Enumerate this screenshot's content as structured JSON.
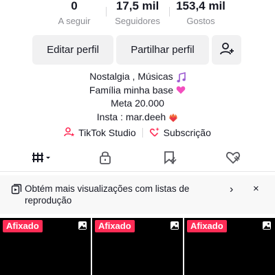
{
  "stats": {
    "following": {
      "value": "0",
      "label": "A seguir"
    },
    "followers": {
      "value": "17,5 mil",
      "label": "Seguidores"
    },
    "likes": {
      "value": "153,4 mil",
      "label": "Gostos"
    }
  },
  "actions": {
    "edit_label": "Editar perfil",
    "share_label": "Partilhar perfil",
    "add_friend_icon": "add-user-icon"
  },
  "bio": {
    "line1": "Nostalgia , Músicas",
    "line1_emoji": "music-notes-emoji",
    "line2": "Família minha base",
    "line2_emoji": "pink-heart-emoji",
    "line3": "Meta 20.000",
    "line4": "Insta : mar.deeh",
    "line4_emoji": "heart-on-fire-emoji"
  },
  "links": {
    "studio_label": "TikTok Studio",
    "studio_icon": "person-star-icon",
    "subscription_label": "Subscrição",
    "subscription_icon": "sparkle-heart-icon"
  },
  "tabs": [
    {
      "icon": "videos-grid-icon"
    },
    {
      "icon": "lock-icon"
    },
    {
      "icon": "bookmark-icon"
    },
    {
      "icon": "heart-icon"
    }
  ],
  "banner": {
    "text": "Obtém mais visualizações com listas de reprodução",
    "icon": "playlist-icon",
    "chevron": "›",
    "close": "×"
  },
  "grid": {
    "tiles": [
      {
        "badge": "Afixado",
        "icon": "photo-icon"
      },
      {
        "badge": "Afixado",
        "icon": "photo-icon"
      },
      {
        "badge": "Afixado",
        "icon": "photo-icon"
      }
    ]
  },
  "colors": {
    "accent": "#fe2c55",
    "button_bg": "#f1f1f2",
    "secondary_text": "#8a8b91"
  }
}
